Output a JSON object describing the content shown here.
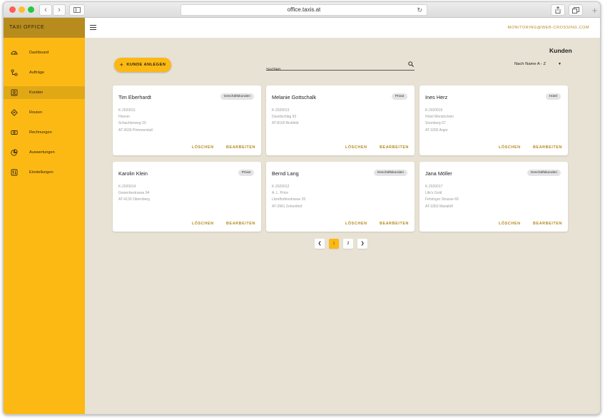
{
  "browser": {
    "url": "office.taxis.at"
  },
  "sidebar": {
    "brand": "TAXI OFFICE",
    "items": [
      {
        "label": "Dashboard",
        "icon": "gauge-icon"
      },
      {
        "label": "Aufträge",
        "icon": "route-icon"
      },
      {
        "label": "Kunden",
        "icon": "contacts-icon",
        "active": true
      },
      {
        "label": "Routen",
        "icon": "directions-icon"
      },
      {
        "label": "Rechnungen",
        "icon": "money-icon"
      },
      {
        "label": "Auswertungen",
        "icon": "pie-chart-icon"
      },
      {
        "label": "Einstellungen",
        "icon": "sliders-icon"
      }
    ]
  },
  "header": {
    "user_email": "MONITORING@WEB-CROSSING.COM"
  },
  "main": {
    "title": "Kunden",
    "add_button_label": "KUNDE ANLEGEN",
    "search_placeholder": "Suchen",
    "sort_label": "Nach Name A - Z",
    "customers": [
      {
        "name": "Tim Eberhardt",
        "type": "Geschäftskunden",
        "id": "K-2020011",
        "line1": "Hoover",
        "line2": "Schachterweg 20",
        "line3": "AT-3630  Pömmerstall"
      },
      {
        "name": "Melanie Gottschalk",
        "type": "Privat",
        "id": "K-2020013",
        "line1": "Davidschlag 93",
        "line2": "AT-8160  Bickfeld",
        "line3": ""
      },
      {
        "name": "Ines Herz",
        "type": "Hotel",
        "id": "K-2020015",
        "line1": "Hotel Mondschein",
        "line2": "Sonnberg 67",
        "line3": "AT-3292  Arger"
      },
      {
        "name": "Karolin Klein",
        "type": "Privat",
        "id": "K-2020014",
        "line1": "Gewerbestrasse 94",
        "line2": "AT-4133  Obernberg",
        "line3": ""
      },
      {
        "name": "Bernd Lang",
        "type": "Geschäftskunden",
        "id": "K-2020012",
        "line1": "A. L. Price",
        "line2": "Litzelhofenstrasse 20",
        "line3": "AT-3961  Zehenthof"
      },
      {
        "name": "Jana Möller",
        "type": "Geschäftskunden",
        "id": "K-2020017",
        "line1": "Life's Gold",
        "line2": "Fehringer Strasse 69",
        "line3": "AT-3353  Mariahilf"
      }
    ],
    "delete_label": "LÖSCHEN",
    "edit_label": "BEARBEITEN",
    "pagination": {
      "pages": [
        "1",
        "2"
      ],
      "current": "1"
    }
  },
  "colors": {
    "accent": "#fcb913",
    "brand_bar": "#b78c1d",
    "background": "#e8e2d4",
    "link": "#b58a1d"
  }
}
